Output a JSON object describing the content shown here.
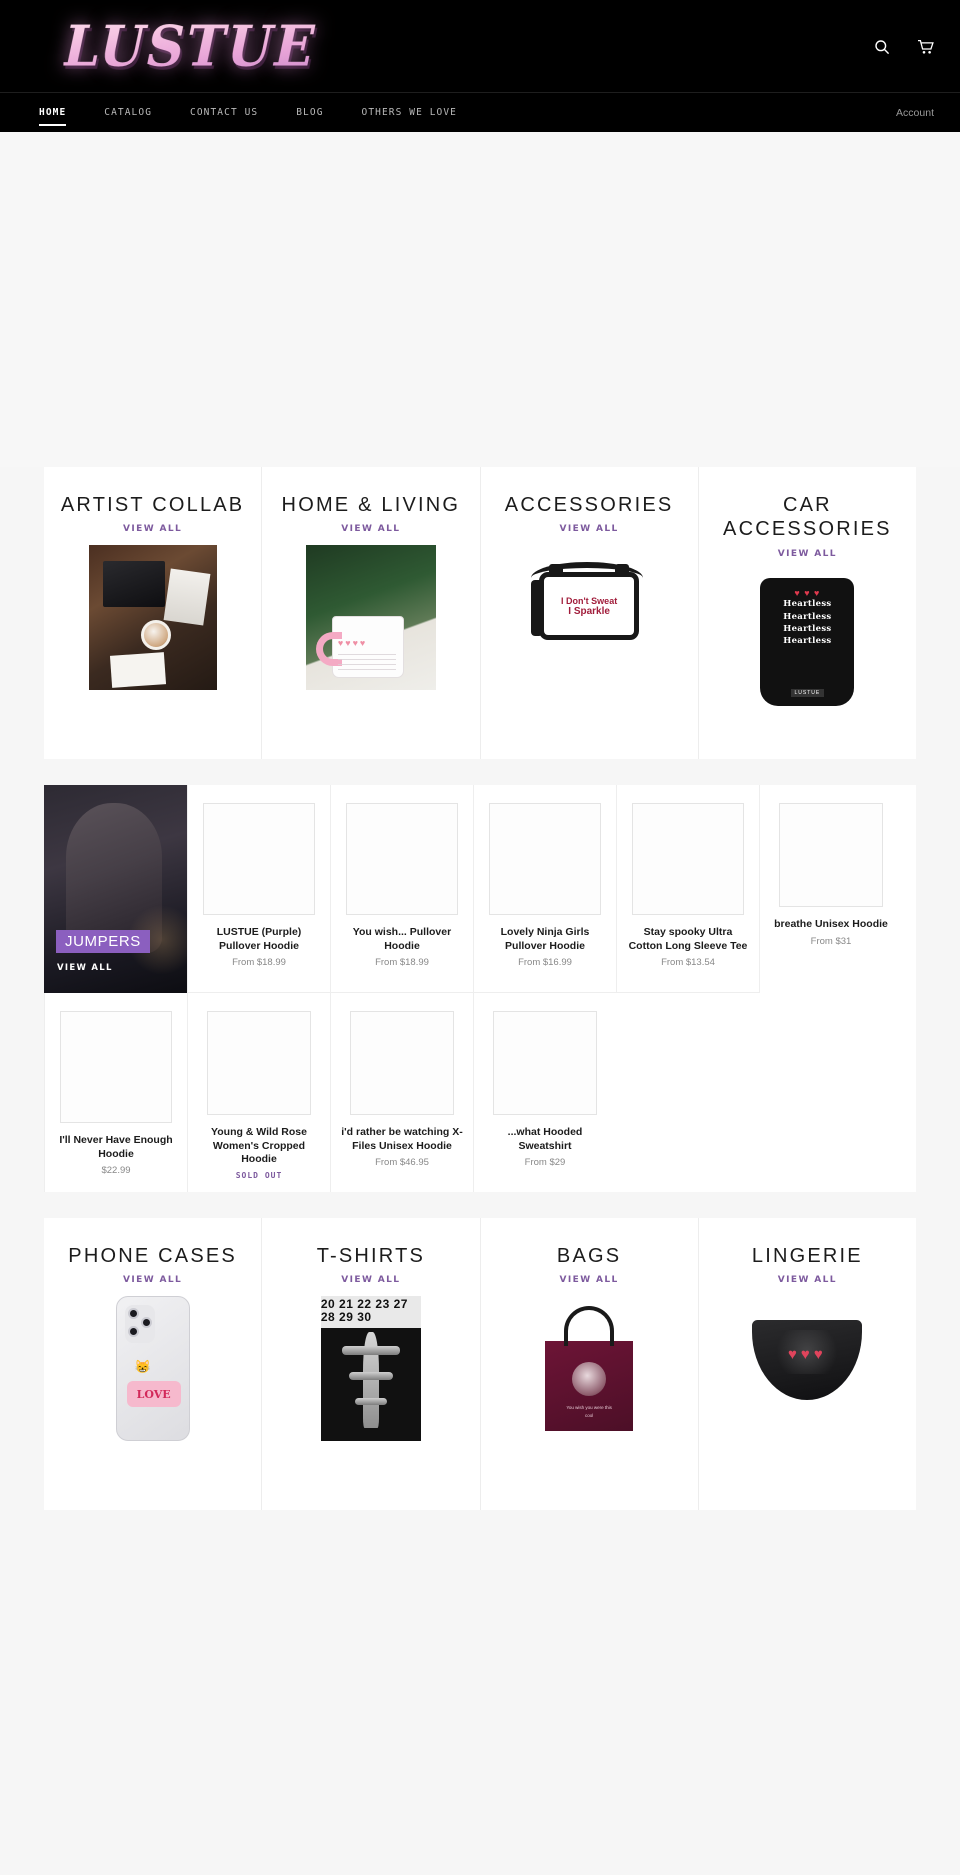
{
  "header": {
    "logo_text": "LUSTUE",
    "search_icon": "search-icon",
    "cart_icon": "cart-icon"
  },
  "nav": {
    "items": [
      {
        "label": "HOME",
        "active": true
      },
      {
        "label": "CATALOG",
        "active": false
      },
      {
        "label": "CONTACT US",
        "active": false
      },
      {
        "label": "BLOG",
        "active": false
      },
      {
        "label": "OTHERS WE LOVE",
        "active": false
      }
    ],
    "account_label": "Account"
  },
  "view_all_label": "VIEW ALL",
  "collections_top": [
    {
      "title": "ARTIST COLLAB",
      "view_all": "VIEW ALL",
      "art": "artist-desk"
    },
    {
      "title": "HOME & LIVING",
      "view_all": "VIEW ALL",
      "art": "mug"
    },
    {
      "title": "ACCESSORIES",
      "view_all": "VIEW ALL",
      "art": "bag",
      "art_text_line1": "I Don't Sweat",
      "art_text_line2": "I Sparkle"
    },
    {
      "title": "CAR ACCESSORIES",
      "view_all": "VIEW ALL",
      "art": "car-mat",
      "art_word": "Heartless",
      "art_hearts": "♥ ♥ ♥",
      "art_brand": "LUSTUE"
    }
  ],
  "collections_bottom": [
    {
      "title": "PHONE CASES",
      "view_all": "VIEW ALL",
      "art": "phone",
      "art_text": "LOVE"
    },
    {
      "title": "T-SHIRTS",
      "view_all": "VIEW ALL",
      "art": "tee",
      "art_numbers": "20 21 22 23 27 28 29 30"
    },
    {
      "title": "BAGS",
      "view_all": "VIEW ALL",
      "art": "tote",
      "art_caption": "You wish you were this cool"
    },
    {
      "title": "LINGERIE",
      "view_all": "VIEW ALL",
      "art": "panties",
      "art_hearts": "♥♥♥"
    }
  ],
  "promo_tile": {
    "label": "JUMPERS",
    "view_all": "VIEW ALL"
  },
  "products_row1": [
    {
      "name": "LUSTUE (Purple) Pullover Hoodie",
      "price": "From $18.99",
      "sold_out": false
    },
    {
      "name": "You wish... Pullover Hoodie",
      "price": "From $18.99",
      "sold_out": false
    },
    {
      "name": "Lovely Ninja Girls Pullover Hoodie",
      "price": "From $16.99",
      "sold_out": false
    },
    {
      "name": "Stay spooky Ultra Cotton Long Sleeve Tee",
      "price": "From $13.54",
      "sold_out": false
    }
  ],
  "products_row2": [
    {
      "name": "breathe Unisex Hoodie",
      "price": "From $31",
      "sold_out": false
    },
    {
      "name": "I'll Never Have Enough Hoodie",
      "price": "$22.99",
      "sold_out": false
    },
    {
      "name": "Young & Wild Rose Women's Cropped Hoodie",
      "price": "SOLD OUT",
      "sold_out": true
    },
    {
      "name": "i'd rather be watching X-Files Unisex Hoodie",
      "price": "From $46.95",
      "sold_out": false
    },
    {
      "name": "...what Hooded Sweatshirt",
      "price": "From $29",
      "sold_out": false
    }
  ],
  "colors": {
    "accent_purple": "#7d5a9e",
    "promo_purple": "#8b5fbf",
    "header_black": "#000000",
    "page_background": "#f6f6f6"
  }
}
